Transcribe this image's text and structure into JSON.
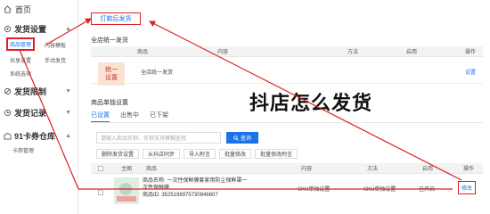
{
  "sidebar": {
    "home": "首页",
    "sections": [
      {
        "label": "发货设置",
        "items": [
          "商品管理",
          "内容模板",
          "共享设置",
          "手动发货",
          "系统选项"
        ]
      },
      {
        "label": "发货限制"
      },
      {
        "label": "发货记录"
      },
      {
        "label": "91卡券仓库",
        "items": [
          "卡券管理"
        ]
      }
    ]
  },
  "main": {
    "top_button": "打款后发货",
    "unified": {
      "title": "全店统一发货",
      "columns": [
        "商品",
        "内容",
        "方法",
        "启用",
        "操作"
      ],
      "row": {
        "thumb": "统一\n设置",
        "text": "全店统一发货",
        "action": "设置"
      }
    },
    "overlay_title": "抖店怎么发货",
    "single": {
      "title": "商品单独设置",
      "tabs": [
        "已设置",
        "出售中",
        "已下架"
      ],
      "search_placeholder": "请输入商品名称、名称支持模糊查找",
      "search_button": "查询",
      "actions": [
        "删除发货设置",
        "从抖店同步",
        "导入附言",
        "批量修改",
        "批量修改附言"
      ],
      "columns": [
        "主图",
        "商品",
        "内容",
        "方法",
        "启用",
        "操作"
      ],
      "row": {
        "name_line1": "商品名称: 一次性保鲜膜套家用防尘保鲜罩一",
        "name_line2": "次性保鲜膜",
        "id_line": "商品ID: 3525198975730846607",
        "content": "SKU单独设置",
        "method": "SKU单独设置",
        "enabled": "已开启",
        "action": "修改"
      }
    }
  },
  "colors": {
    "accent": "#1a73e8",
    "annotation": "#e02020"
  }
}
